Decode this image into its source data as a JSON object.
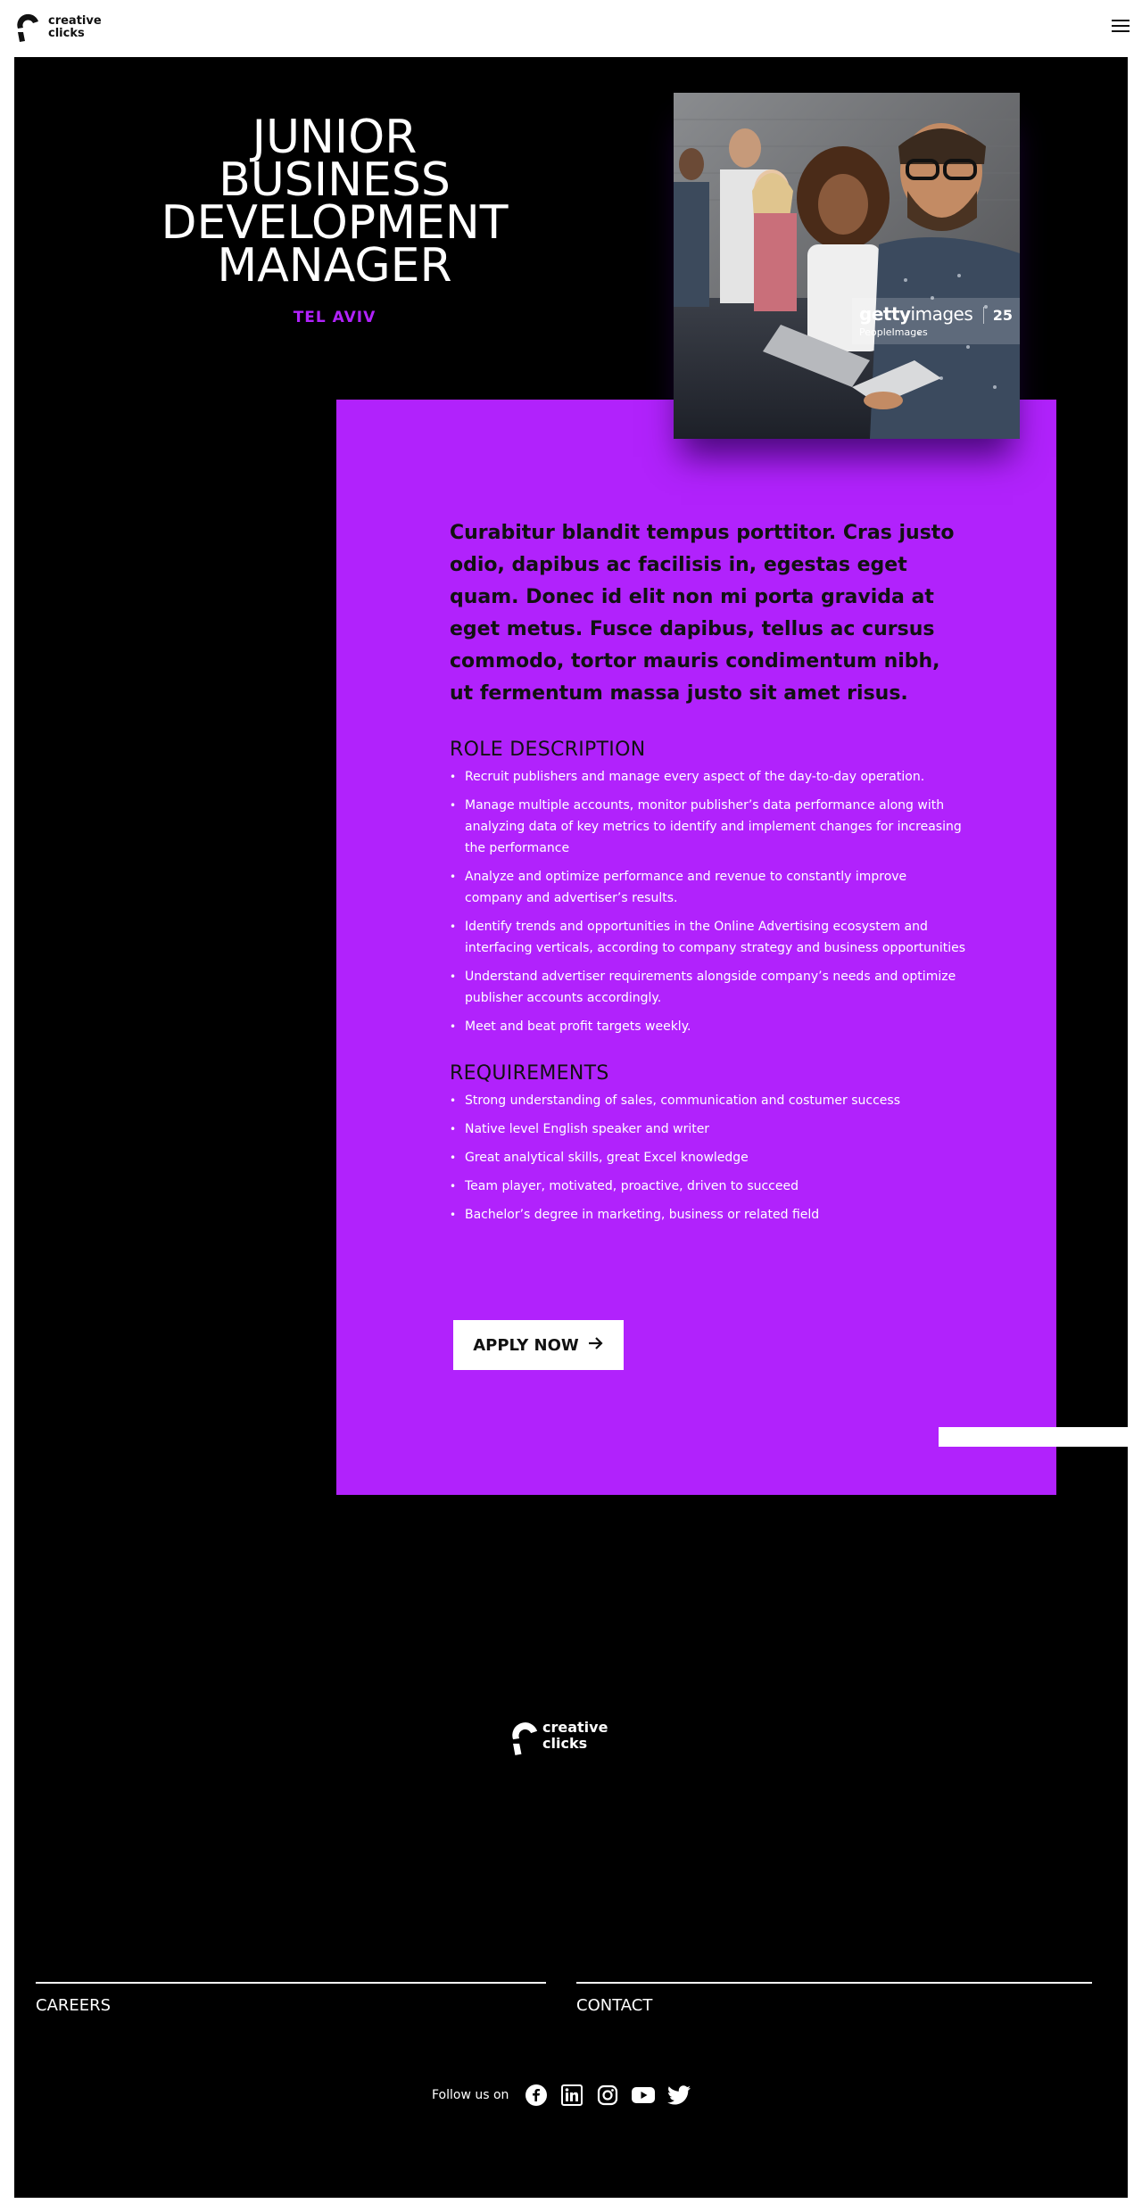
{
  "header": {
    "logo_line1": "creative",
    "logo_line2": "clicks",
    "menu_icon": "hamburger-menu-icon"
  },
  "hero": {
    "title": "JUNIOR BUSINESS DEVELOPMENT MANAGER",
    "location": "TEL AVIV",
    "photo_watermark": {
      "brand_bold": "getty",
      "brand_light": "images",
      "credit": "PeopleImages",
      "years": "25"
    }
  },
  "content": {
    "intro": "Curabitur blandit tempus porttitor. Cras justo odio, dapibus ac facilisis in, egestas eget quam. Donec id elit non mi porta gravida at eget metus. Fusce dapibus, tellus ac cursus commodo, tortor mauris condimentum nibh, ut fermentum massa justo sit amet risus.",
    "role_heading": "ROLE DESCRIPTION",
    "role_items": [
      "Recruit publishers and manage every aspect of the day-to-day operation.",
      "Manage multiple accounts, monitor publisher’s data performance along with analyzing data of key metrics to identify and implement changes for increasing the performance",
      "Analyze and optimize performance and revenue to constantly improve company and advertiser’s results.",
      "Identify trends and opportunities in the Online Advertising ecosystem and interfacing verticals, according to company strategy and business opportunities",
      "Understand advertiser requirements alongside company’s needs and optimize publisher accounts accordingly.",
      "Meet and beat profit targets weekly."
    ],
    "req_heading": "REQUIREMENTS",
    "req_items": [
      "Strong understanding of sales, communication and costumer success",
      "Native level English speaker and writer",
      "Great analytical skills, great Excel knowledge",
      "Team player, motivated, proactive, driven to succeed",
      "Bachelor’s degree in marketing, business or related field"
    ],
    "apply_label": "APPLY NOW",
    "apply_icon": "arrow-right-icon"
  },
  "footer": {
    "logo_line1": "creative",
    "logo_line2": "clicks",
    "careers": "CAREERS",
    "contact": "CONTACT",
    "follow_label": "Follow us on",
    "social": [
      "facebook-icon",
      "linkedin-icon",
      "instagram-icon",
      "youtube-icon",
      "twitter-icon"
    ]
  },
  "colors": {
    "accent": "#b122fc",
    "background": "#000000",
    "header_bg": "#ffffff"
  }
}
